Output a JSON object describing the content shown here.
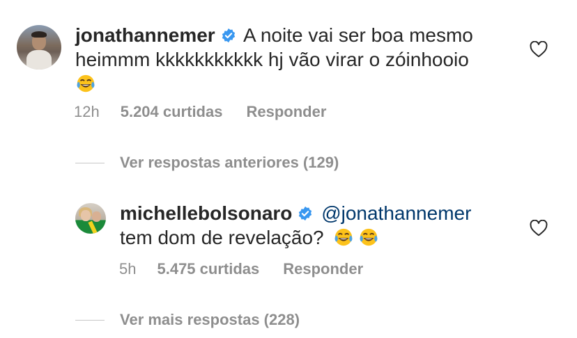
{
  "comments": [
    {
      "username": "jonathannemer",
      "text_line1": "A noite vai ser boa mesmo",
      "text_line2": "heimmm kkkkkkkkkkk hj vão virar o zóinhooio",
      "emoji": "😂",
      "time": "12h",
      "likes": "5.204 curtidas",
      "reply": "Responder",
      "verified_color": "#3897f0"
    },
    {
      "username": "michellebolsonaro",
      "mention": "@jonathannemer",
      "text_line2": "tem dom de revelação?",
      "emoji_count": 2,
      "time": "5h",
      "likes": "5.475 curtidas",
      "reply": "Responder",
      "verified_color": "#3897f0"
    }
  ],
  "view_previous_replies": "Ver respostas anteriores (129)",
  "view_more_replies": "Ver mais respostas (228)",
  "icons": {
    "like": "heart-outline-icon",
    "verified": "verified-badge-icon",
    "emoji": "tears-of-joy-emoji"
  }
}
